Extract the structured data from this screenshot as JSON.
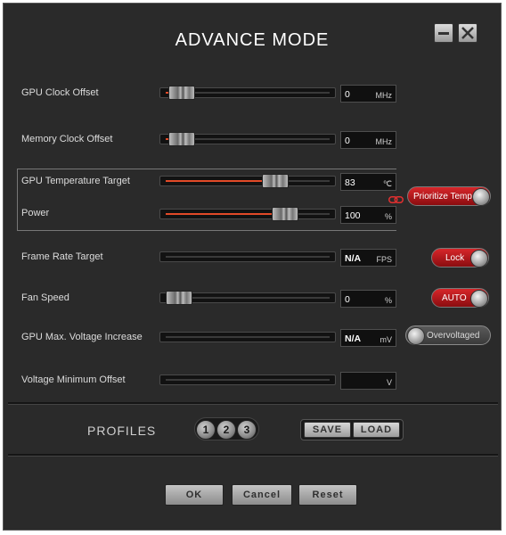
{
  "window": {
    "title": "ADVANCE MODE"
  },
  "rows": {
    "gpu_clock": {
      "label": "GPU Clock Offset",
      "value": "0",
      "unit": "MHz",
      "fill_fraction": 0.02
    },
    "memory_clock": {
      "label": "Memory Clock Offset",
      "value": "0",
      "unit": "MHz",
      "fill_fraction": 0.02
    },
    "gpu_temp": {
      "label": "GPU Temperature Target",
      "value": "83",
      "unit": "℃",
      "fill_fraction": 0.69
    },
    "power": {
      "label": "Power",
      "value": "100",
      "unit": "%",
      "fill_fraction": 0.76
    },
    "frame_rate": {
      "label": "Frame Rate Target",
      "value": "N/A",
      "unit": "FPS"
    },
    "fan_speed": {
      "label": "Fan Speed",
      "value": "0",
      "unit": "%",
      "fill_fraction": 0.0
    },
    "gpu_voltage": {
      "label": "GPU Max. Voltage Increase",
      "value": "N/A",
      "unit": "mV"
    },
    "voltage_min": {
      "label": "Voltage Minimum Offset",
      "value": "",
      "unit": "V"
    }
  },
  "toggles": {
    "prioritize_temp": "Prioritize Temp.",
    "lock": "Lock",
    "auto": "AUTO",
    "overvoltaged": "Overvoltaged"
  },
  "profiles": {
    "label": "PROFILES",
    "slots": [
      "1",
      "2",
      "3"
    ],
    "save_label": "SAVE",
    "load_label": "LOAD"
  },
  "footer": {
    "ok_label": "OK",
    "cancel_label": "Cancel",
    "reset_label": "Reset"
  },
  "colors": {
    "accent": "#e24a28",
    "toggle_red": "#c8181c",
    "background": "#2a2a2a"
  }
}
